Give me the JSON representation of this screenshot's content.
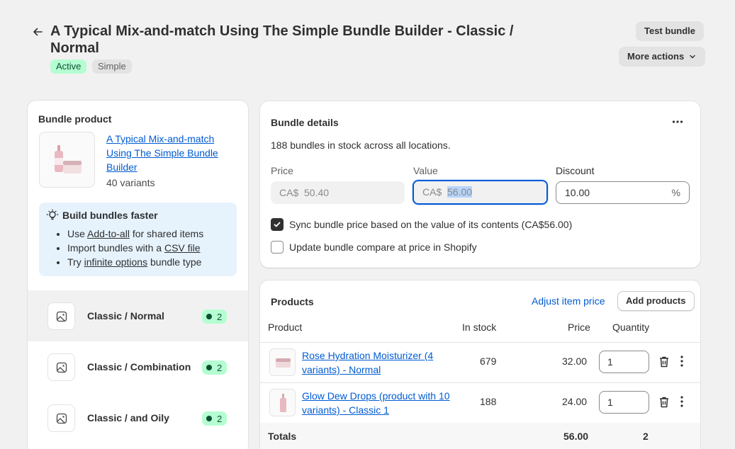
{
  "header": {
    "title": "A Typical Mix-and-match Using The Simple Bundle Builder - Classic / Normal",
    "status_badge": "Active",
    "type_badge": "Simple",
    "test_bundle_label": "Test bundle",
    "more_actions_label": "More actions"
  },
  "bundle_product": {
    "heading": "Bundle product",
    "product_link": "A Typical Mix-and-match Using The Simple Bundle Builder",
    "variants_text": "40 variants",
    "tip": {
      "heading": "Build bundles faster",
      "item1_pre": "Use ",
      "item1_link": "Add-to-all",
      "item1_post": " for shared items",
      "item2_pre": "Import bundles with a ",
      "item2_link": "CSV file",
      "item3_pre": "Try ",
      "item3_link": "infinite options",
      "item3_post": " bundle type"
    },
    "variants": [
      {
        "name": "Classic / Normal",
        "count": "2"
      },
      {
        "name": "Classic / Combination",
        "count": "2"
      },
      {
        "name": "Classic / and Oily",
        "count": "2"
      }
    ]
  },
  "bundle_details": {
    "heading": "Bundle details",
    "stock_text": "188 bundles in stock across all locations.",
    "price_label": "Price",
    "price_prefix": "CA$",
    "price_value": "50.40",
    "value_label": "Value",
    "value_prefix": "CA$",
    "value_value": "56.00",
    "discount_label": "Discount",
    "discount_value": "10.00",
    "discount_suffix": "%",
    "sync_label": "Sync bundle price based on the value of its contents (CA$56.00)",
    "sync_checked": true,
    "compare_label": "Update bundle compare at price in Shopify",
    "compare_checked": false
  },
  "products": {
    "heading": "Products",
    "adjust_label": "Adjust item price",
    "add_label": "Add products",
    "columns": {
      "product": "Product",
      "stock": "In stock",
      "price": "Price",
      "quantity": "Quantity"
    },
    "rows": [
      {
        "name": "Rose Hydration Moisturizer (4 variants) - Normal",
        "stock": "679",
        "price": "32.00",
        "qty": "1"
      },
      {
        "name": "Glow Dew Drops (product with 10 variants) - Classic 1",
        "stock": "188",
        "price": "24.00",
        "qty": "1"
      }
    ],
    "totals_label": "Totals",
    "totals_price": "56.00",
    "totals_qty": "2"
  },
  "colors": {
    "accent": "#005bd3",
    "success_bg": "#b4fed2",
    "success_text": "#0c5132",
    "tip_bg": "#e6f3fd"
  }
}
